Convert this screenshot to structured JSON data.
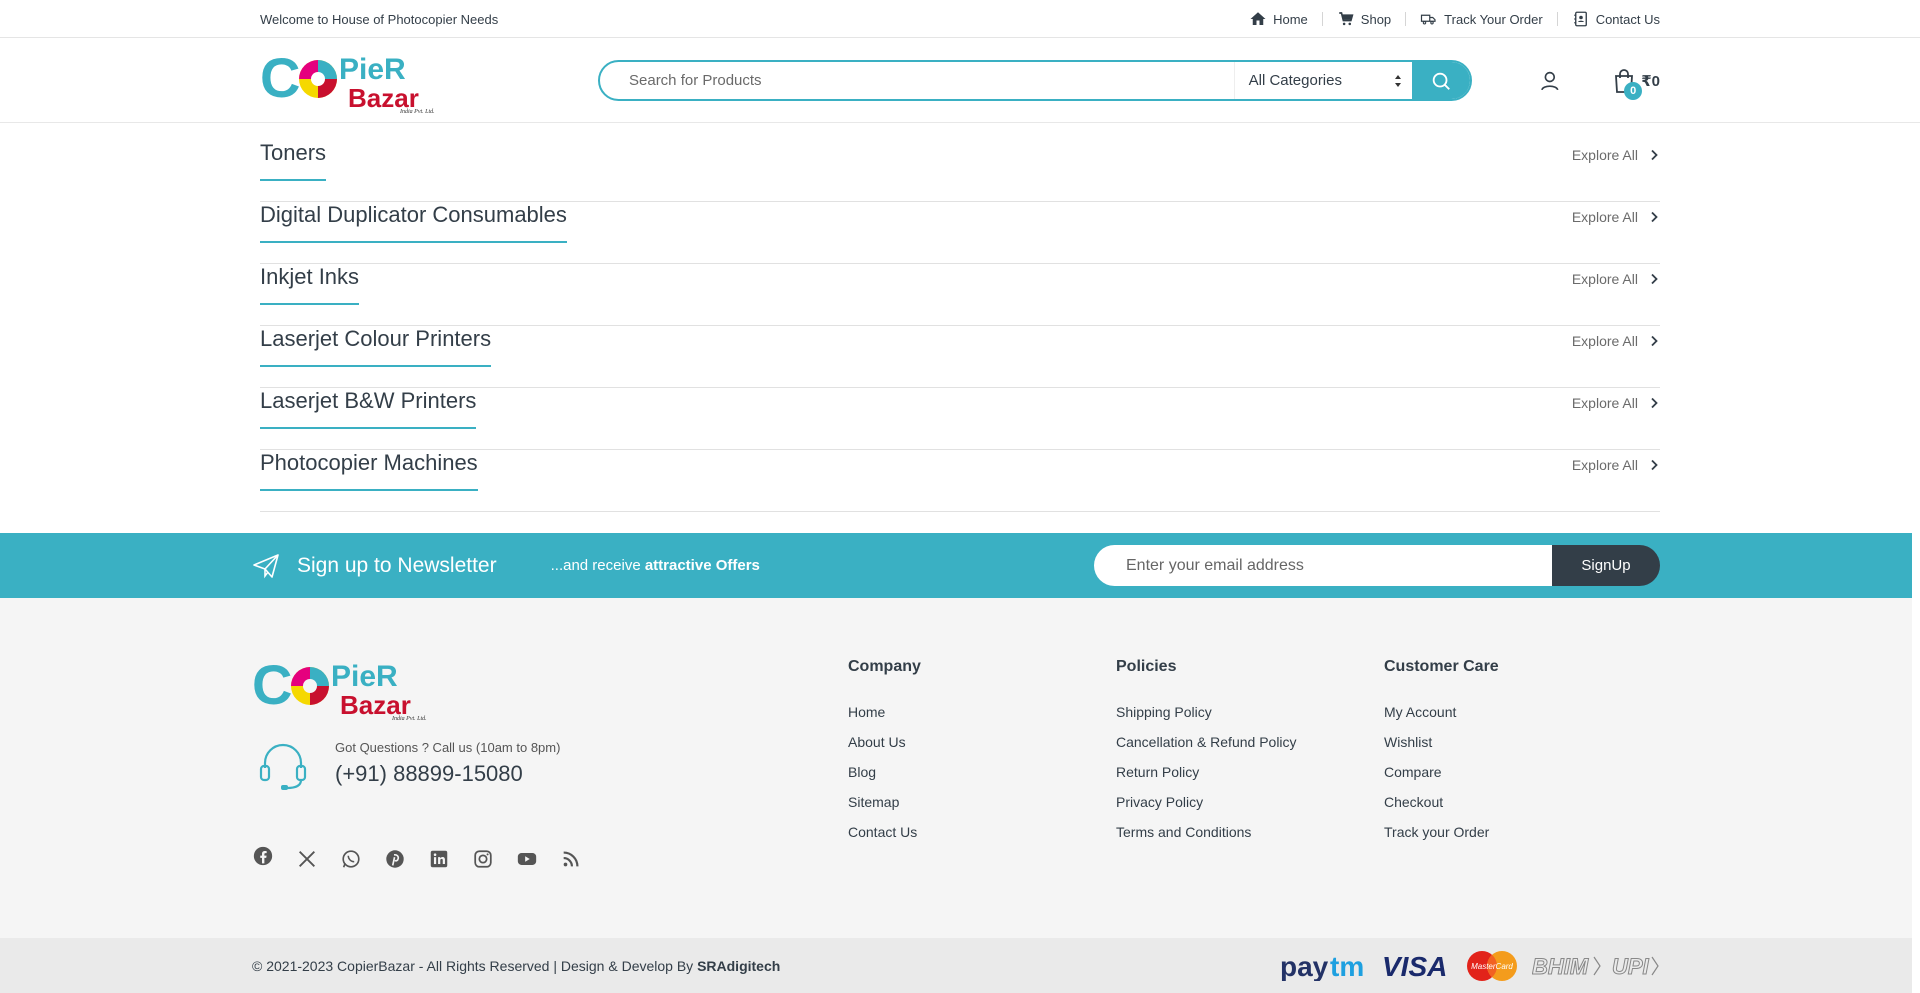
{
  "topbar": {
    "welcome": "Welcome to House of Photocopier Needs",
    "nav": [
      {
        "label": "Home",
        "icon": "home-icon"
      },
      {
        "label": "Shop",
        "icon": "cart-icon"
      },
      {
        "label": "Track Your Order",
        "icon": "truck-icon"
      },
      {
        "label": "Contact Us",
        "icon": "contact-card-icon"
      }
    ]
  },
  "header": {
    "logo_text_main": "COPIER",
    "logo_text_sub": "Bazar",
    "logo_tagline": "India Pvt. Ltd.",
    "search_placeholder": "Search for Products",
    "category_selected": "All Categories",
    "cart_count": "0",
    "cart_total": "₹0"
  },
  "categories": [
    {
      "title": "Toners",
      "link": "Explore All"
    },
    {
      "title": "Digital Duplicator Consumables",
      "link": "Explore All"
    },
    {
      "title": "Inkjet Inks",
      "link": "Explore All"
    },
    {
      "title": "Laserjet Colour Printers",
      "link": "Explore All"
    },
    {
      "title": "Laserjet B&W Printers",
      "link": "Explore All"
    },
    {
      "title": "Photocopier Machines",
      "link": "Explore All"
    }
  ],
  "newsletter": {
    "title": "Sign up to Newsletter",
    "sub_prefix": "...and receive ",
    "sub_bold": "attractive Offers",
    "email_placeholder": "Enter your email address",
    "button": "SignUp"
  },
  "footer": {
    "support_question": "Got Questions ? Call us (10am to 8pm)",
    "phone": "(+91) 88899-15080",
    "columns": [
      {
        "title": "Company",
        "links": [
          "Home",
          "About Us",
          "Blog",
          "Sitemap",
          "Contact Us"
        ]
      },
      {
        "title": "Policies",
        "links": [
          "Shipping Policy",
          "Cancellation & Refund Policy",
          "Return Policy",
          "Privacy Policy",
          "Terms and Conditions"
        ]
      },
      {
        "title": "Customer Care",
        "links": [
          "My Account",
          "Wishlist",
          "Compare",
          "Checkout",
          "Track your Order"
        ]
      }
    ],
    "socials": [
      "facebook-icon",
      "x-twitter-icon",
      "whatsapp-icon",
      "pinterest-icon",
      "linkedin-icon",
      "instagram-icon",
      "youtube-icon",
      "rss-icon"
    ],
    "copyright": "© 2021-2023 CopierBazar - All Rights Reserved | Design & Develop By ",
    "developer": "SRAdigitech",
    "payments": [
      "Paytm",
      "VISA",
      "MasterCard",
      "BHIM",
      "UPI"
    ]
  },
  "colors": {
    "accent": "#3ab0c3",
    "dark": "#333e48",
    "logo_red": "#c8102e",
    "logo_yellow": "#f5d800",
    "logo_magenta": "#e5007e"
  }
}
